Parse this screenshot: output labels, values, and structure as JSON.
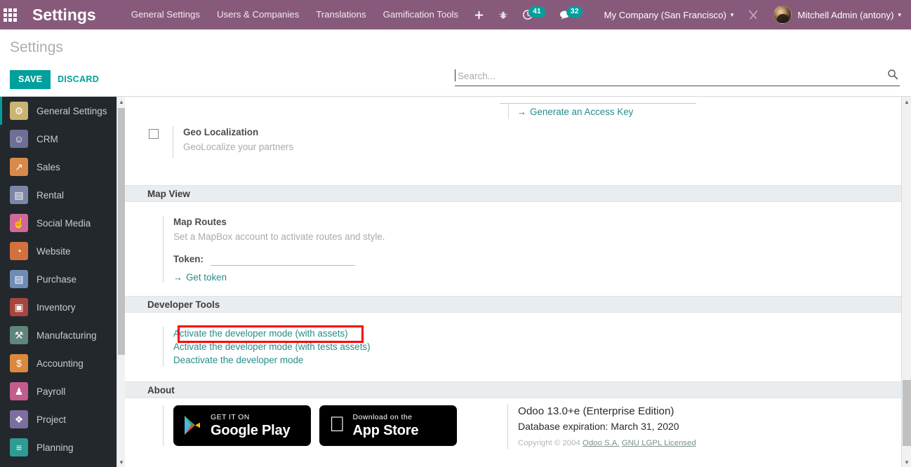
{
  "topbar": {
    "apps_icon": "apps-grid-icon",
    "brand": "Settings",
    "menus": [
      {
        "label": "General Settings"
      },
      {
        "label": "Users & Companies"
      },
      {
        "label": "Translations"
      },
      {
        "label": "Gamification Tools"
      }
    ],
    "plus_icon": "plus-icon",
    "bug_icon": "bug-icon",
    "activities": {
      "icon": "clock-icon",
      "count": "41"
    },
    "messages": {
      "icon": "chat-bubble-icon",
      "count": "32"
    },
    "company": "My Company (San Francisco)",
    "company_caret": "▾",
    "tools_icon": "wrench-screwdriver-icon",
    "user": "Mitchell Admin (antony)",
    "user_caret": "▾",
    "avatar": "user-avatar",
    "bg_color": "#875A7B"
  },
  "control": {
    "page_title": "Settings",
    "save_label": "SAVE",
    "discard_label": "DISCARD",
    "accent_color": "#00A09D"
  },
  "search": {
    "value": "",
    "placeholder": "Search...",
    "icon": "search-icon"
  },
  "sidebar": {
    "items": [
      {
        "label": "General Settings",
        "icon": "gear-icon",
        "glyph": "⚙",
        "color": "#C9B572",
        "active": true
      },
      {
        "label": "CRM",
        "icon": "handshake-icon",
        "glyph": "☺",
        "color": "#6E6E96",
        "active": false
      },
      {
        "label": "Sales",
        "icon": "chart-line-icon",
        "glyph": "↗",
        "color": "#D98A4B",
        "active": false
      },
      {
        "label": "Rental",
        "icon": "document-icon",
        "glyph": "▤",
        "color": "#7C87A8",
        "active": false
      },
      {
        "label": "Social Media",
        "icon": "thumbs-up-icon",
        "glyph": "☝",
        "color": "#D1689A",
        "active": false
      },
      {
        "label": "Website",
        "icon": "globe-icon",
        "glyph": "◔",
        "color": "#D2713F",
        "active": false
      },
      {
        "label": "Purchase",
        "icon": "card-icon",
        "glyph": "▤",
        "color": "#6E8CB5",
        "active": false
      },
      {
        "label": "Inventory",
        "icon": "box-icon",
        "glyph": "▣",
        "color": "#A8453F",
        "active": false
      },
      {
        "label": "Manufacturing",
        "icon": "wrench-icon",
        "glyph": "⚒",
        "color": "#60857A",
        "active": false
      },
      {
        "label": "Accounting",
        "icon": "invoice-icon",
        "glyph": "$",
        "color": "#D98A3F",
        "active": false
      },
      {
        "label": "Payroll",
        "icon": "employee-icon",
        "glyph": "♟",
        "color": "#C45C8E",
        "active": false
      },
      {
        "label": "Project",
        "icon": "puzzle-icon",
        "glyph": "❖",
        "color": "#7C6E9E",
        "active": false
      },
      {
        "label": "Planning",
        "icon": "schedule-icon",
        "glyph": "≡",
        "color": "#2E9B94",
        "active": false
      }
    ],
    "scroll_up": "▲",
    "scroll_down": "▼"
  },
  "main": {
    "access_key": {
      "arrow": "→",
      "label": "Generate an Access Key"
    },
    "geo_localization": {
      "checked": false,
      "title": "Geo Localization",
      "description": "GeoLocalize your partners"
    },
    "sections": [
      {
        "id": "map-view",
        "title": "Map View"
      },
      {
        "id": "developer-tools",
        "title": "Developer Tools"
      },
      {
        "id": "about",
        "title": "About"
      }
    ],
    "map_view": {
      "title": "Map Routes",
      "description": "Set a MapBox account to activate routes and style.",
      "token_label": "Token:",
      "token_value": "",
      "get_token": {
        "arrow": "→",
        "label": "Get token"
      }
    },
    "developer_tools": {
      "links": [
        {
          "label": "Activate the developer mode (with assets)",
          "highlighted": true
        },
        {
          "label": "Activate the developer mode (with tests assets)",
          "highlighted": false
        },
        {
          "label": "Deactivate the developer mode",
          "highlighted": false
        }
      ],
      "highlight_color": "#FF0000"
    },
    "about": {
      "google_play": {
        "small": "GET IT ON",
        "big": "Google Play"
      },
      "app_store": {
        "small": "Download on the",
        "big": "App Store"
      },
      "version": "Odoo 13.0+e (Enterprise Edition)",
      "expiration": "Database expiration: March 31, 2020",
      "copyright_prefix": "Copyright © 2004",
      "copyright_link1": "Odoo S.A.",
      "copyright_link2": "GNU LGPL Licensed"
    }
  },
  "scroll": {
    "up": "▲",
    "down": "▼"
  }
}
